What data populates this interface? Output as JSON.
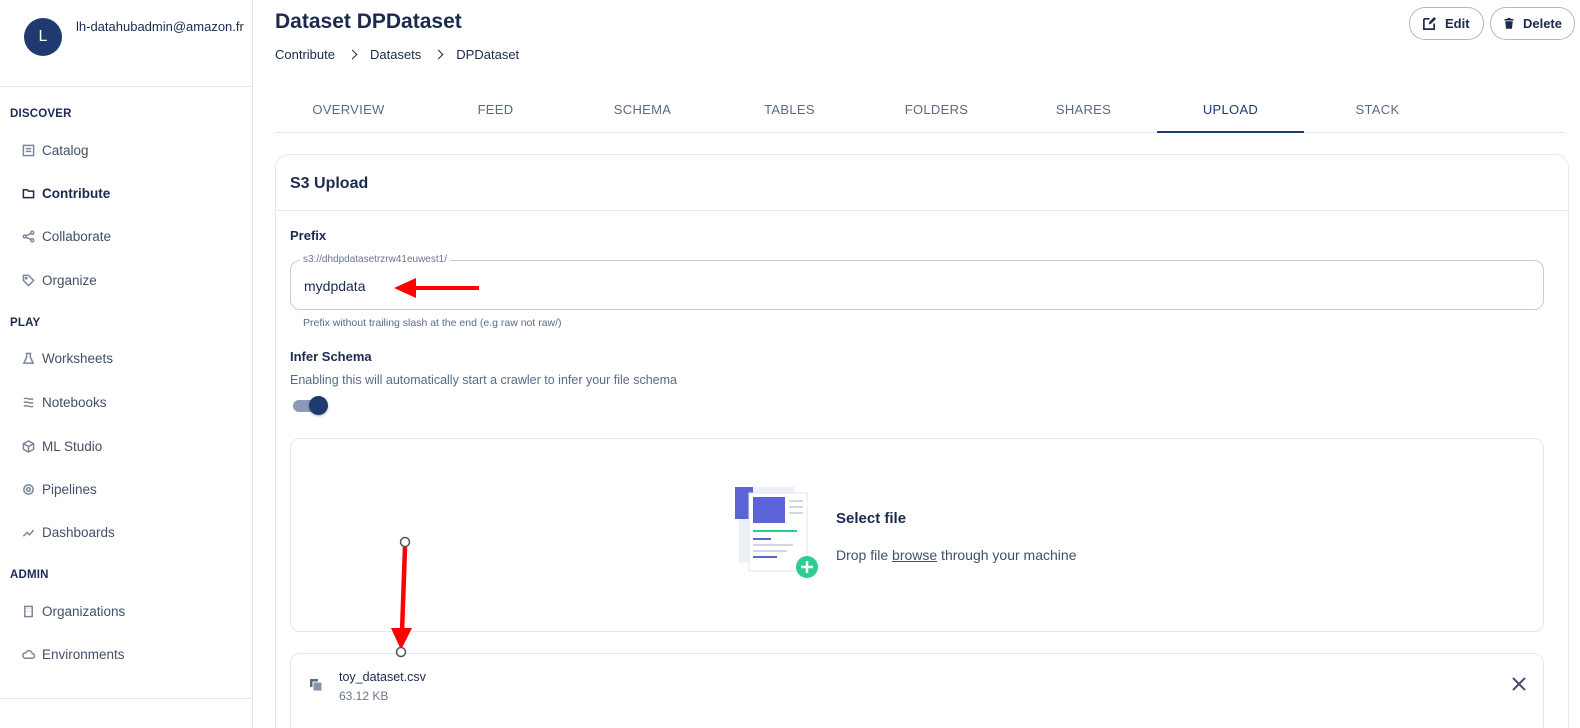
{
  "user": {
    "initial": "L",
    "email": "lh-datahubadmin@amazon.fr"
  },
  "sidebar": {
    "sections": [
      {
        "label": "DISCOVER"
      },
      {
        "label": "PLAY"
      },
      {
        "label": "ADMIN"
      }
    ],
    "items": [
      {
        "label": "Catalog",
        "icon": "catalog-icon"
      },
      {
        "label": "Contribute",
        "icon": "folder-icon",
        "active": true
      },
      {
        "label": "Collaborate",
        "icon": "share-icon"
      },
      {
        "label": "Organize",
        "icon": "tag-icon"
      },
      {
        "label": "Worksheets",
        "icon": "flask-icon"
      },
      {
        "label": "Notebooks",
        "icon": "notebook-icon"
      },
      {
        "label": "ML Studio",
        "icon": "cube-icon"
      },
      {
        "label": "Pipelines",
        "icon": "gear-icon"
      },
      {
        "label": "Dashboards",
        "icon": "trend-icon"
      },
      {
        "label": "Organizations",
        "icon": "building-icon"
      },
      {
        "label": "Environments",
        "icon": "cloud-icon"
      }
    ]
  },
  "header": {
    "title": "Dataset DPDataset",
    "breadcrumbs": [
      "Contribute",
      "Datasets",
      "DPDataset"
    ],
    "edit_label": "Edit",
    "delete_label": "Delete"
  },
  "tabs": [
    "OVERVIEW",
    "FEED",
    "SCHEMA",
    "TABLES",
    "FOLDERS",
    "SHARES",
    "UPLOAD",
    "STACK"
  ],
  "active_tab": "UPLOAD",
  "upload": {
    "card_title": "S3 Upload",
    "prefix_label": "Prefix",
    "prefix_legend": "s3://dhdpdatasetrzrw41euwest1/",
    "prefix_value": "mydpdata",
    "prefix_helper": "Prefix without trailing slash at the end (e.g raw not raw/)",
    "infer_label": "Infer Schema",
    "infer_description": "Enabling this will automatically start a crawler to infer your file schema",
    "infer_enabled": true,
    "drop_title": "Select file",
    "drop_text_before": "Drop file ",
    "drop_link": "browse",
    "drop_text_after": " through your machine",
    "file": {
      "name": "toy_dataset.csv",
      "size": "63.12 KB"
    }
  },
  "colors": {
    "primary": "#1e3a6e",
    "annotation": "#ff0000",
    "accent_green": "#2ecc8f"
  }
}
